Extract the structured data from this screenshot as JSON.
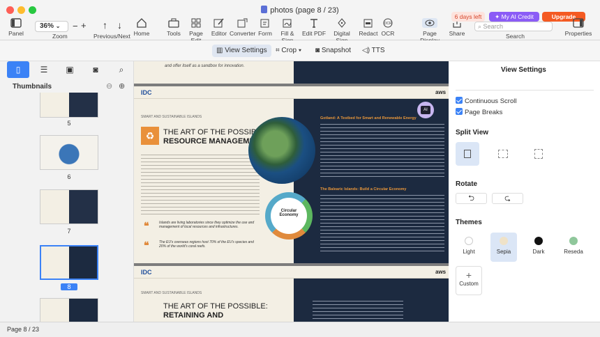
{
  "window": {
    "title": "photos (page 8 / 23)"
  },
  "toolbar": {
    "panel": "Panel",
    "zoom_value": "36%",
    "zoom": "Zoom",
    "prevnext": "Previous/Next",
    "home": "Home",
    "tools": "Tools",
    "page_edit": "Page Edit",
    "editor": "Editor",
    "converter": "Converter",
    "form": "Form",
    "fill_sign": "Fill & Sign",
    "edit_pdf": "Edit PDF",
    "digital_sign": "Digital Sign",
    "redact": "Redact",
    "ocr": "OCR",
    "page_display": "Page Display",
    "share": "Share",
    "search": "Search",
    "search_placeholder": "Search",
    "properties": "Properties",
    "days_left": "6 days left",
    "my_ai_credit": "My AI Credit",
    "upgrade": "Upgrade"
  },
  "subtoolbar": {
    "view_settings": "View Settings",
    "crop": "Crop",
    "snapshot": "Snapshot",
    "tts": "TTS"
  },
  "sidebar": {
    "title": "Thumbnails",
    "pages": [
      "5",
      "6",
      "7",
      "8"
    ],
    "selected_page": "8"
  },
  "document": {
    "page_top_text": "and offer itself as a sandbox for innovation.",
    "idc": "IDC",
    "aws": "aws",
    "section_label": "SMART AND SUSTAINABLE ISLANDS",
    "heading_line1": "THE ART OF THE POSSIBLE:",
    "heading_line2": "RESOURCE MANAGEMENT",
    "circular_label": "Circular Economy",
    "gotland_title": "Gotland: A Testbed for Smart and Renewable Energy",
    "balearic_title": "The Balearic Islands: Build a Circular Economy",
    "quote1": "Islands are living laboratories since they optimize the use and management of local resources and infrastructures.",
    "quote2": "The EU's overseas regions host 70% of the EU's species and 20% of the world's coral reefs.",
    "next_heading_line1": "THE ART OF THE POSSIBLE:",
    "next_heading_line2": "RETAINING AND",
    "ai_badge": "AI"
  },
  "right_panel": {
    "title": "View Settings",
    "continuous_scroll": "Continuous Scroll",
    "page_breaks": "Page Breaks",
    "split_view": "Split View",
    "rotate": "Rotate",
    "themes": "Themes",
    "theme_options": [
      {
        "label": "Light",
        "color": "#ffffff"
      },
      {
        "label": "Sepia",
        "color": "#efe2c8"
      },
      {
        "label": "Dark",
        "color": "#111111"
      },
      {
        "label": "Reseda",
        "color": "#8fc79b"
      }
    ],
    "custom": "Custom"
  },
  "status": {
    "page": "Page 8 / 23"
  },
  "colors": {
    "accent": "#3b82f6",
    "upgrade": "#f45a22",
    "ai_credit": "#8b5cf6",
    "days_left_bg": "#fde3dd"
  }
}
